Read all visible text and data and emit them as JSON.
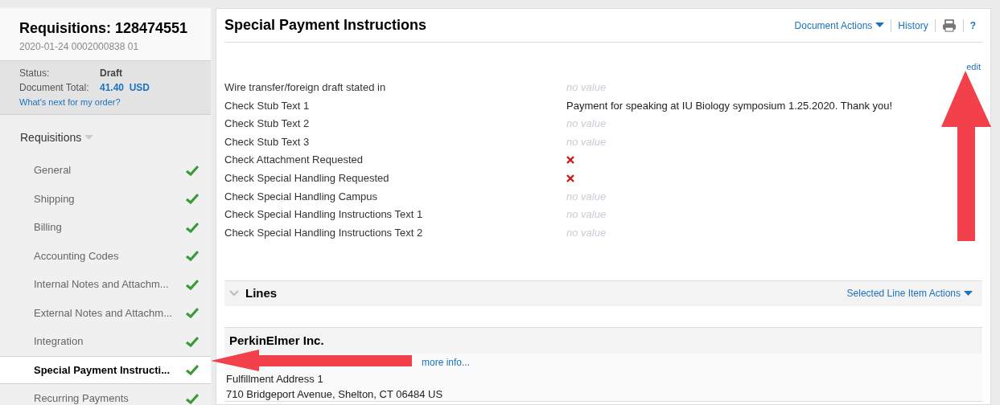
{
  "requisition": {
    "title": "Requisitions: 128474551",
    "subtitle": "2020-01-24 0002000838 01",
    "status_label": "Status:",
    "status_value": "Draft",
    "total_label": "Document Total:",
    "total_value": "41.40  USD",
    "next_link": "What's next for my order?"
  },
  "sidebar": {
    "heading": "Requisitions",
    "items": [
      {
        "label": "General",
        "done": true,
        "selected": false
      },
      {
        "label": "Shipping",
        "done": true,
        "selected": false
      },
      {
        "label": "Billing",
        "done": true,
        "selected": false
      },
      {
        "label": "Accounting Codes",
        "done": true,
        "selected": false
      },
      {
        "label": "Internal Notes and Attachm...",
        "done": true,
        "selected": false
      },
      {
        "label": "External Notes and Attachm...",
        "done": true,
        "selected": false
      },
      {
        "label": "Integration",
        "done": true,
        "selected": false
      },
      {
        "label": "Special Payment Instructi...",
        "done": true,
        "selected": true
      },
      {
        "label": "Recurring Payments",
        "done": true,
        "selected": false
      }
    ]
  },
  "main": {
    "title": "Special Payment Instructions",
    "actions": [
      "Document Actions",
      "History"
    ],
    "help": "?",
    "edit": "edit",
    "fields": [
      {
        "label": "Wire transfer/foreign draft stated in",
        "kind": "empty",
        "value": "no value"
      },
      {
        "label": "Check Stub Text 1",
        "kind": "text",
        "value": "Payment for speaking at IU Biology symposium 1.25.2020. Thank you!"
      },
      {
        "label": "Check Stub Text 2",
        "kind": "empty",
        "value": "no value"
      },
      {
        "label": "Check Stub Text 3",
        "kind": "empty",
        "value": "no value"
      },
      {
        "label": "Check Attachment Requested",
        "kind": "flag",
        "checked": false
      },
      {
        "label": "Check Special Handling Requested",
        "kind": "flag",
        "checked": false
      },
      {
        "label": "Check Special Handling Campus",
        "kind": "empty",
        "value": "no value"
      },
      {
        "label": "Check Special Handling Instructions Text 1",
        "kind": "empty",
        "value": "no value"
      },
      {
        "label": "Check Special Handling Instructions Text 2",
        "kind": "empty",
        "value": "no value"
      }
    ]
  },
  "lines": {
    "title": "Lines",
    "expanded": true,
    "actions": "Selected Line Item Actions",
    "supplier": "PerkinElmer Inc.",
    "more_info": "more info...",
    "address_label": "Fulfillment Address 1",
    "address": "710 Bridgeport Avenue, Shelton, CT 06484 US"
  }
}
